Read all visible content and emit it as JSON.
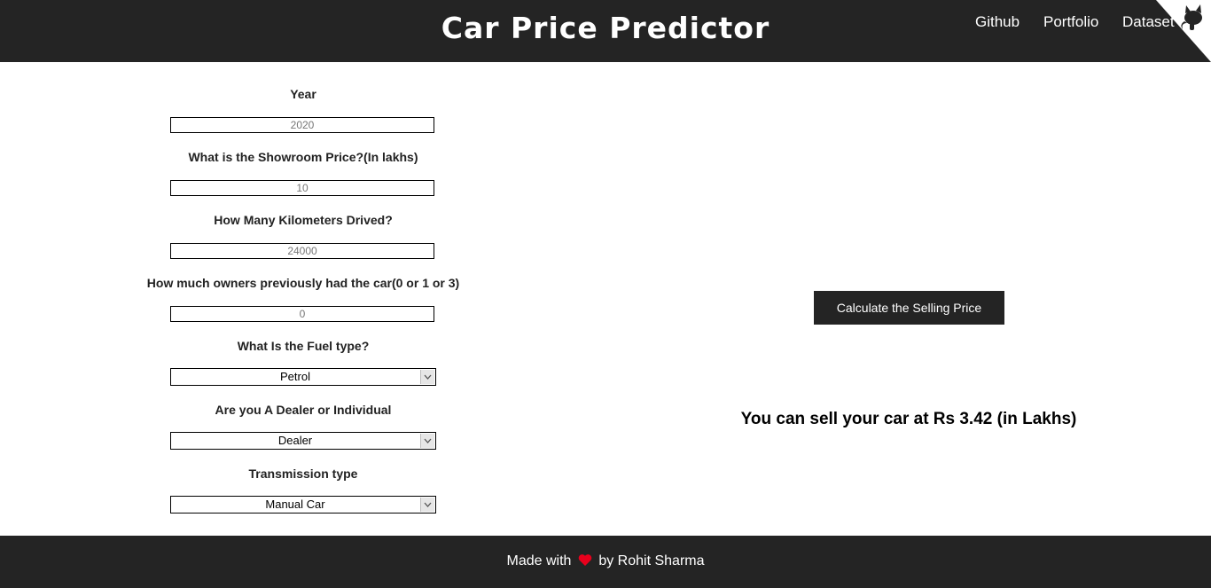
{
  "header": {
    "title": "Car Price Predictor",
    "nav": {
      "github": "Github",
      "portfolio": "Portfolio",
      "dataset": "Dataset"
    },
    "corner_icon": "github-corner-octocat-icon"
  },
  "form": {
    "year": {
      "label": "Year",
      "value": "2020"
    },
    "showroom_price": {
      "label": "What is the Showroom Price?(In lakhs)",
      "value": "10"
    },
    "kms_driven": {
      "label": "How Many Kilometers Drived?",
      "value": "24000"
    },
    "owners": {
      "label": "How much owners previously had the car(0 or 1 or 3)",
      "value": "0"
    },
    "fuel_type": {
      "label": "What Is the Fuel type?",
      "selected": "Petrol"
    },
    "seller_type": {
      "label": "Are you A Dealer or Individual",
      "selected": "Dealer"
    },
    "transmission": {
      "label": "Transmission type",
      "selected": "Manual Car"
    }
  },
  "action": {
    "calculate_label": "Calculate the Selling Price"
  },
  "result": {
    "text": "You can sell your car at Rs 3.42 (in Lakhs)"
  },
  "footer": {
    "made_with": "Made with",
    "by": "by Rohit Sharma",
    "heart_icon": "heart-icon"
  },
  "colors": {
    "header_bg": "#242424",
    "footer_bg": "#242424",
    "heart": "#e8001c",
    "button_bg": "#242424"
  }
}
